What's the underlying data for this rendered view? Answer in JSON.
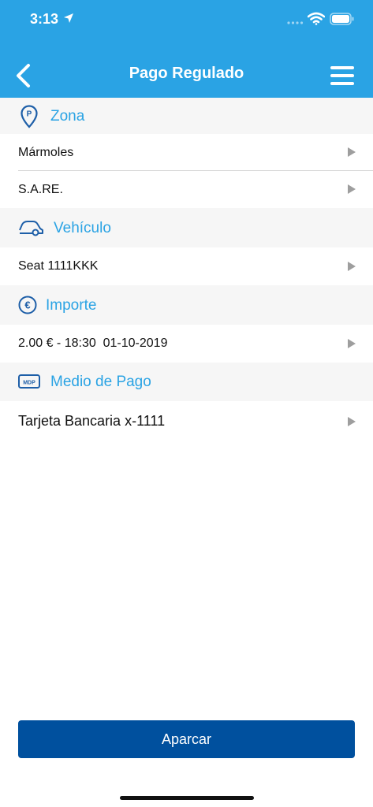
{
  "status_bar": {
    "time": "3:13"
  },
  "nav": {
    "title": "Pago Regulado"
  },
  "sections": {
    "zona": {
      "title": "Zona",
      "icon_text": "P",
      "rows": [
        "Mármoles",
        "S.A.RE."
      ]
    },
    "vehiculo": {
      "title": "Vehículo",
      "rows": [
        "Seat 1111KKK"
      ]
    },
    "importe": {
      "title": "Importe",
      "icon_text": "€",
      "rows": [
        "2.00 € - 18:30  01-10-2019"
      ]
    },
    "medio_pago": {
      "title": "Medio de Pago",
      "icon_text": "MDP",
      "rows": [
        "Tarjeta Bancaria x-1111"
      ]
    }
  },
  "footer": {
    "button_label": "Aparcar"
  },
  "colors": {
    "primary": "#2AA3E4",
    "button": "#00509E",
    "section_bg": "#F6F6F6",
    "arrow": "#9E9E9E"
  }
}
